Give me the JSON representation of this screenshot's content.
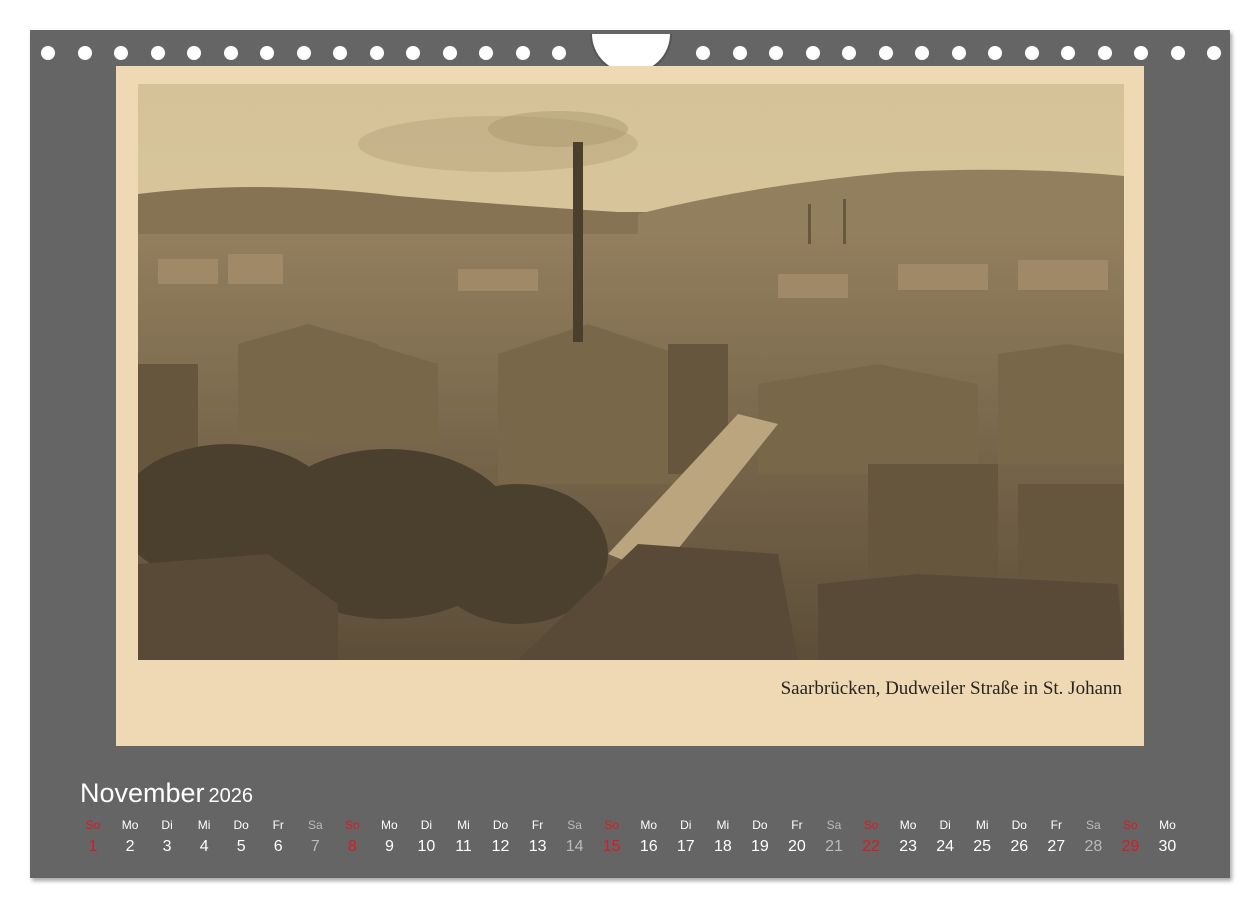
{
  "photo": {
    "caption": "Saarbrücken, Dudweiler Straße in St. Johann"
  },
  "calendar": {
    "month": "November",
    "year": "2026",
    "colors": {
      "background": "#656565",
      "mat": "#eed9b4",
      "sunday": "#d81b23",
      "saturday": "#bbbbbb",
      "weekday": "#ffffff"
    },
    "days": [
      {
        "wd": "So",
        "d": "1",
        "type": "sun"
      },
      {
        "wd": "Mo",
        "d": "2",
        "type": "wk"
      },
      {
        "wd": "Di",
        "d": "3",
        "type": "wk"
      },
      {
        "wd": "Mi",
        "d": "4",
        "type": "wk"
      },
      {
        "wd": "Do",
        "d": "5",
        "type": "wk"
      },
      {
        "wd": "Fr",
        "d": "6",
        "type": "wk"
      },
      {
        "wd": "Sa",
        "d": "7",
        "type": "sat"
      },
      {
        "wd": "So",
        "d": "8",
        "type": "sun"
      },
      {
        "wd": "Mo",
        "d": "9",
        "type": "wk"
      },
      {
        "wd": "Di",
        "d": "10",
        "type": "wk"
      },
      {
        "wd": "Mi",
        "d": "11",
        "type": "wk"
      },
      {
        "wd": "Do",
        "d": "12",
        "type": "wk"
      },
      {
        "wd": "Fr",
        "d": "13",
        "type": "wk"
      },
      {
        "wd": "Sa",
        "d": "14",
        "type": "sat"
      },
      {
        "wd": "So",
        "d": "15",
        "type": "sun"
      },
      {
        "wd": "Mo",
        "d": "16",
        "type": "wk"
      },
      {
        "wd": "Di",
        "d": "17",
        "type": "wk"
      },
      {
        "wd": "Mi",
        "d": "18",
        "type": "wk"
      },
      {
        "wd": "Do",
        "d": "19",
        "type": "wk"
      },
      {
        "wd": "Fr",
        "d": "20",
        "type": "wk"
      },
      {
        "wd": "Sa",
        "d": "21",
        "type": "sat"
      },
      {
        "wd": "So",
        "d": "22",
        "type": "sun"
      },
      {
        "wd": "Mo",
        "d": "23",
        "type": "wk"
      },
      {
        "wd": "Di",
        "d": "24",
        "type": "wk"
      },
      {
        "wd": "Mi",
        "d": "25",
        "type": "wk"
      },
      {
        "wd": "Do",
        "d": "26",
        "type": "wk"
      },
      {
        "wd": "Fr",
        "d": "27",
        "type": "wk"
      },
      {
        "wd": "Sa",
        "d": "28",
        "type": "sat"
      },
      {
        "wd": "So",
        "d": "29",
        "type": "sun"
      },
      {
        "wd": "Mo",
        "d": "30",
        "type": "wk"
      }
    ]
  }
}
